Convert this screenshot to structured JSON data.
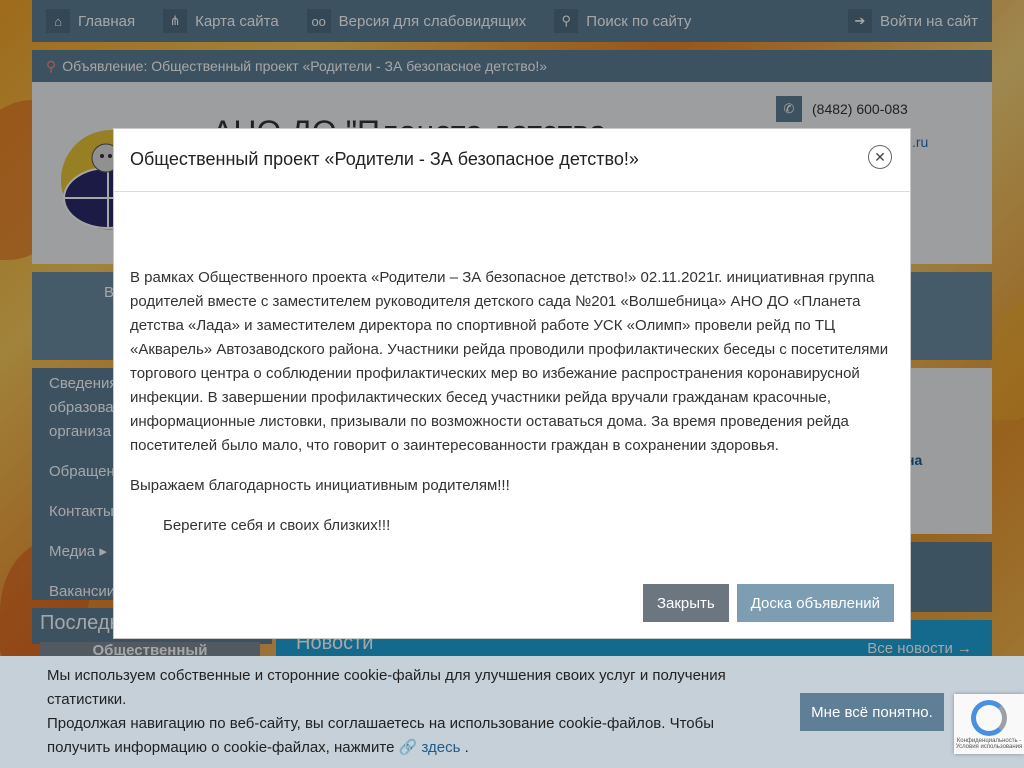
{
  "topbar": {
    "home": "Главная",
    "sitemap": "Карта сайта",
    "accessibility": "Версия для слабовидящих",
    "search": "Поиск по сайту",
    "login": "Войти на сайт"
  },
  "announcement": {
    "text": "Объявление: Общественный проект «Родители - ЗА безопасное детство!»"
  },
  "header": {
    "org_title": "АНО ДО \"Планета детства",
    "phone": "(8482) 600-083",
    "email_fragment": ".ru"
  },
  "menubar": {
    "fragment_left": "В"
  },
  "sidebar": {
    "items": [
      "Сведения образова организа",
      "Обращени",
      "Контакты",
      "Медиа ▸",
      "Вакансии"
    ]
  },
  "right_fragment": "на",
  "latest": "Последн",
  "thumb_title": "Общественный",
  "news": {
    "title": "Новости",
    "all": "Все новости →"
  },
  "modal": {
    "title": "Общественный проект «Родители - ЗА безопасное детство!»",
    "paragraphs": [
      "В рамках Общественного проекта «Родители – ЗА безопасное детство!» 02.11.2021г. инициативная группа родителей вместе с заместителем руководителя детского сада №201 «Волшебница» АНО ДО «Планета детства «Лада» и заместителем директора по спортивной работе УСК «Олимп» провели рейд по ТЦ «Акварель» Автозаводского района. Участники рейда проводили профилактических беседы с посетителями торгового центра о соблюдении профилактических мер во избежание распространения коронавирусной инфекции. В завершении профилактических бесед участники рейда вручали гражданам красочные, информационные листовки, призывали по возможности оставаться дома. За время проведения рейда посетителей было мало, что говорит о заинтересованности граждан в сохранении здоровья.",
      "Выражаем благодарность инициативным родителям!!!",
      "Берегите себя и своих близких!!!"
    ],
    "close_label": "Закрыть",
    "board_label": "Доска объявлений"
  },
  "cookie": {
    "line1": "Мы используем собственные и сторонние cookie-файлы для улучшения своих услуг и получения статистики.",
    "line2": "Продолжая навигацию по веб-сайту, вы соглашаетесь на использование cookie-файлов. Чтобы получить информацию о cookie-файлах, нажмите",
    "link": "здесь",
    "ok": "Мне всё понятно."
  },
  "recaptcha": {
    "text": "Конфиденциальность - Условия использования"
  },
  "colors": {
    "bar": "#5e7f96",
    "news": "#1ea3d8",
    "overlay": "rgba(0,0,0,0.35)"
  }
}
